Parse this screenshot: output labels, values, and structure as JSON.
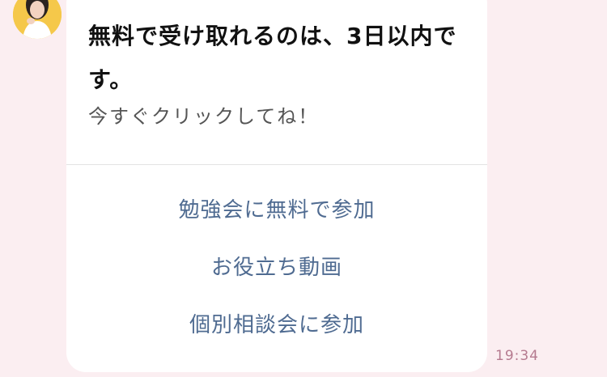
{
  "message": {
    "title": "無料で受け取れるのは、3日以内です。",
    "subtitle": "今すぐクリックしてね！",
    "actions": [
      "勉強会に無料で参加",
      "お役立ち動画",
      "個別相談会に参加"
    ],
    "time": "19:34"
  },
  "avatar": {
    "icon": "profile-photo",
    "background_color": "#f5c84a"
  },
  "colors": {
    "chat_background": "#fbeef1",
    "action_link": "#4f6b91",
    "timestamp": "#b57a8f"
  }
}
